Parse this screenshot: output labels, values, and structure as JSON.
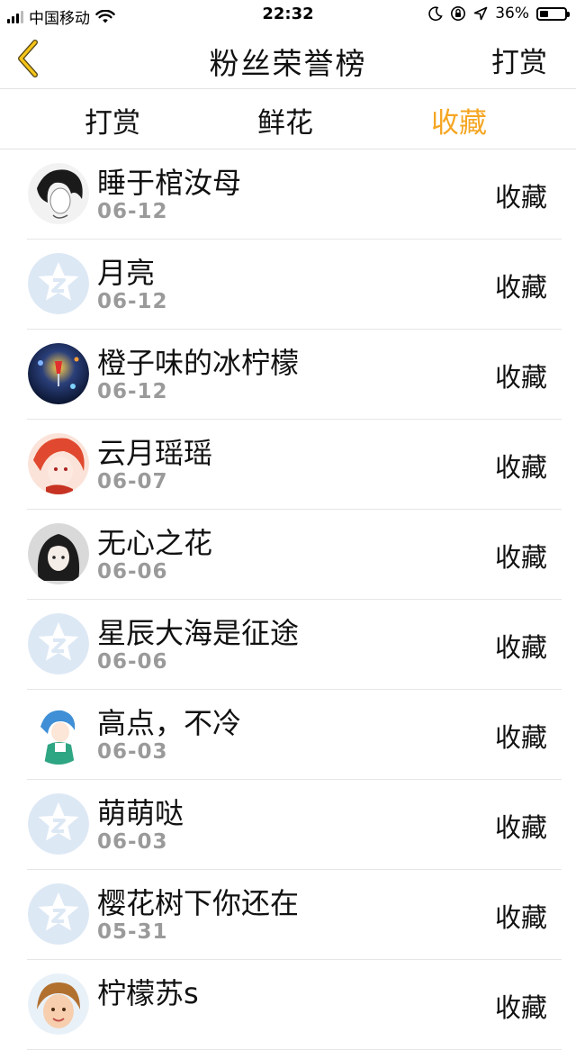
{
  "status_bar": {
    "carrier": "中国移动",
    "time": "22:32",
    "battery": "36%",
    "battery_level": 0.36
  },
  "nav": {
    "title": "粉丝荣誉榜",
    "action": "打赏"
  },
  "tabs": [
    {
      "label": "打赏",
      "active": false
    },
    {
      "label": "鲜花",
      "active": false
    },
    {
      "label": "收藏",
      "active": true
    }
  ],
  "colors": {
    "accent": "#f5a623",
    "date_gray": "#9a9a9a",
    "default_avatar": "#dde8f5"
  },
  "rows": [
    {
      "name": "睡于棺汝母",
      "date": "06-12",
      "tag": "收藏",
      "avatar": "sketch-avatar"
    },
    {
      "name": "月亮",
      "date": "06-12",
      "tag": "收藏",
      "avatar": "default-avatar"
    },
    {
      "name": "橙子味的冰柠檬",
      "date": "06-12",
      "tag": "收藏",
      "avatar": "night-avatar"
    },
    {
      "name": "云月瑶瑶",
      "date": "06-07",
      "tag": "收藏",
      "avatar": "anime-red-avatar"
    },
    {
      "name": "无心之花",
      "date": "06-06",
      "tag": "收藏",
      "avatar": "dark-hair-avatar"
    },
    {
      "name": "星辰大海是征途",
      "date": "06-06",
      "tag": "收藏",
      "avatar": "default-avatar"
    },
    {
      "name": "高点，不冷",
      "date": "06-03",
      "tag": "收藏",
      "avatar": "anime-blue-avatar"
    },
    {
      "name": "萌萌哒",
      "date": "06-03",
      "tag": "收藏",
      "avatar": "default-avatar"
    },
    {
      "name": "樱花树下你还在",
      "date": "05-31",
      "tag": "收藏",
      "avatar": "default-avatar"
    },
    {
      "name": "柠檬苏s",
      "date": "",
      "tag": "收藏",
      "avatar": "child-avatar"
    }
  ]
}
